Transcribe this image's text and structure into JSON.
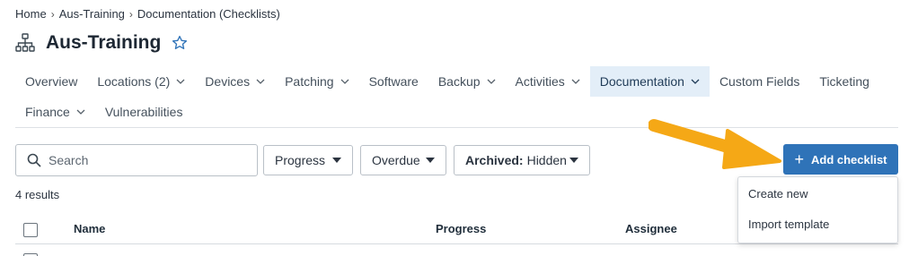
{
  "breadcrumb": [
    "Home",
    "Aus-Training",
    "Documentation (Checklists)"
  ],
  "page": {
    "title": "Aus-Training",
    "icon": "org-chart-icon",
    "favorite_icon": "star-icon"
  },
  "tabs_row1": [
    {
      "label": "Overview",
      "dropdown": false,
      "active": false
    },
    {
      "label": "Locations (2)",
      "dropdown": true,
      "active": false
    },
    {
      "label": "Devices",
      "dropdown": true,
      "active": false
    },
    {
      "label": "Patching",
      "dropdown": true,
      "active": false
    },
    {
      "label": "Software",
      "dropdown": false,
      "active": false
    },
    {
      "label": "Backup",
      "dropdown": true,
      "active": false
    },
    {
      "label": "Activities",
      "dropdown": true,
      "active": false
    },
    {
      "label": "Documentation",
      "dropdown": true,
      "active": true
    },
    {
      "label": "Custom Fields",
      "dropdown": false,
      "active": false
    },
    {
      "label": "Ticketing",
      "dropdown": false,
      "active": false
    }
  ],
  "tabs_row2": [
    {
      "label": "Finance",
      "dropdown": true,
      "active": false
    },
    {
      "label": "Vulnerabilities",
      "dropdown": false,
      "active": false
    }
  ],
  "filters": {
    "search_placeholder": "Search",
    "progress_label": "Progress",
    "overdue_label": "Overdue",
    "archived_label": "Archived:",
    "archived_value": "Hidden"
  },
  "actions": {
    "add_checklist_label": "Add checklist"
  },
  "add_menu": [
    "Create new",
    "Import template"
  ],
  "results_text": "4 results",
  "table": {
    "columns": [
      "Name",
      "Progress",
      "Assignee"
    ]
  },
  "colors": {
    "accent": "#2f73b8",
    "active_tab_bg": "#e3eef8",
    "annotation_arrow": "#f5a816"
  }
}
